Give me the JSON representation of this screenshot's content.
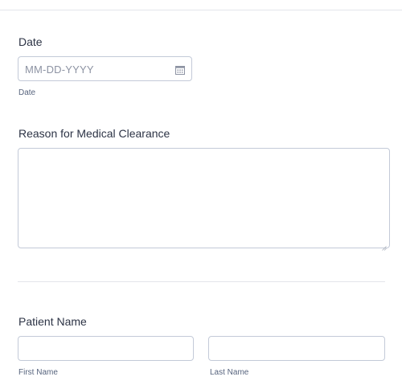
{
  "date_field": {
    "label": "Date",
    "placeholder": "MM-DD-YYYY",
    "sublabel": "Date",
    "icon": "calendar-icon"
  },
  "reason_field": {
    "label": "Reason for Medical Clearance",
    "value": ""
  },
  "patient_name": {
    "label": "Patient Name",
    "first_sublabel": "First Name",
    "last_sublabel": "Last Name",
    "first_value": "",
    "last_value": ""
  },
  "colors": {
    "text": "#2c3345",
    "sublabel": "#57647e",
    "border": "#c3cad8",
    "divider": "#e3e5ea"
  }
}
